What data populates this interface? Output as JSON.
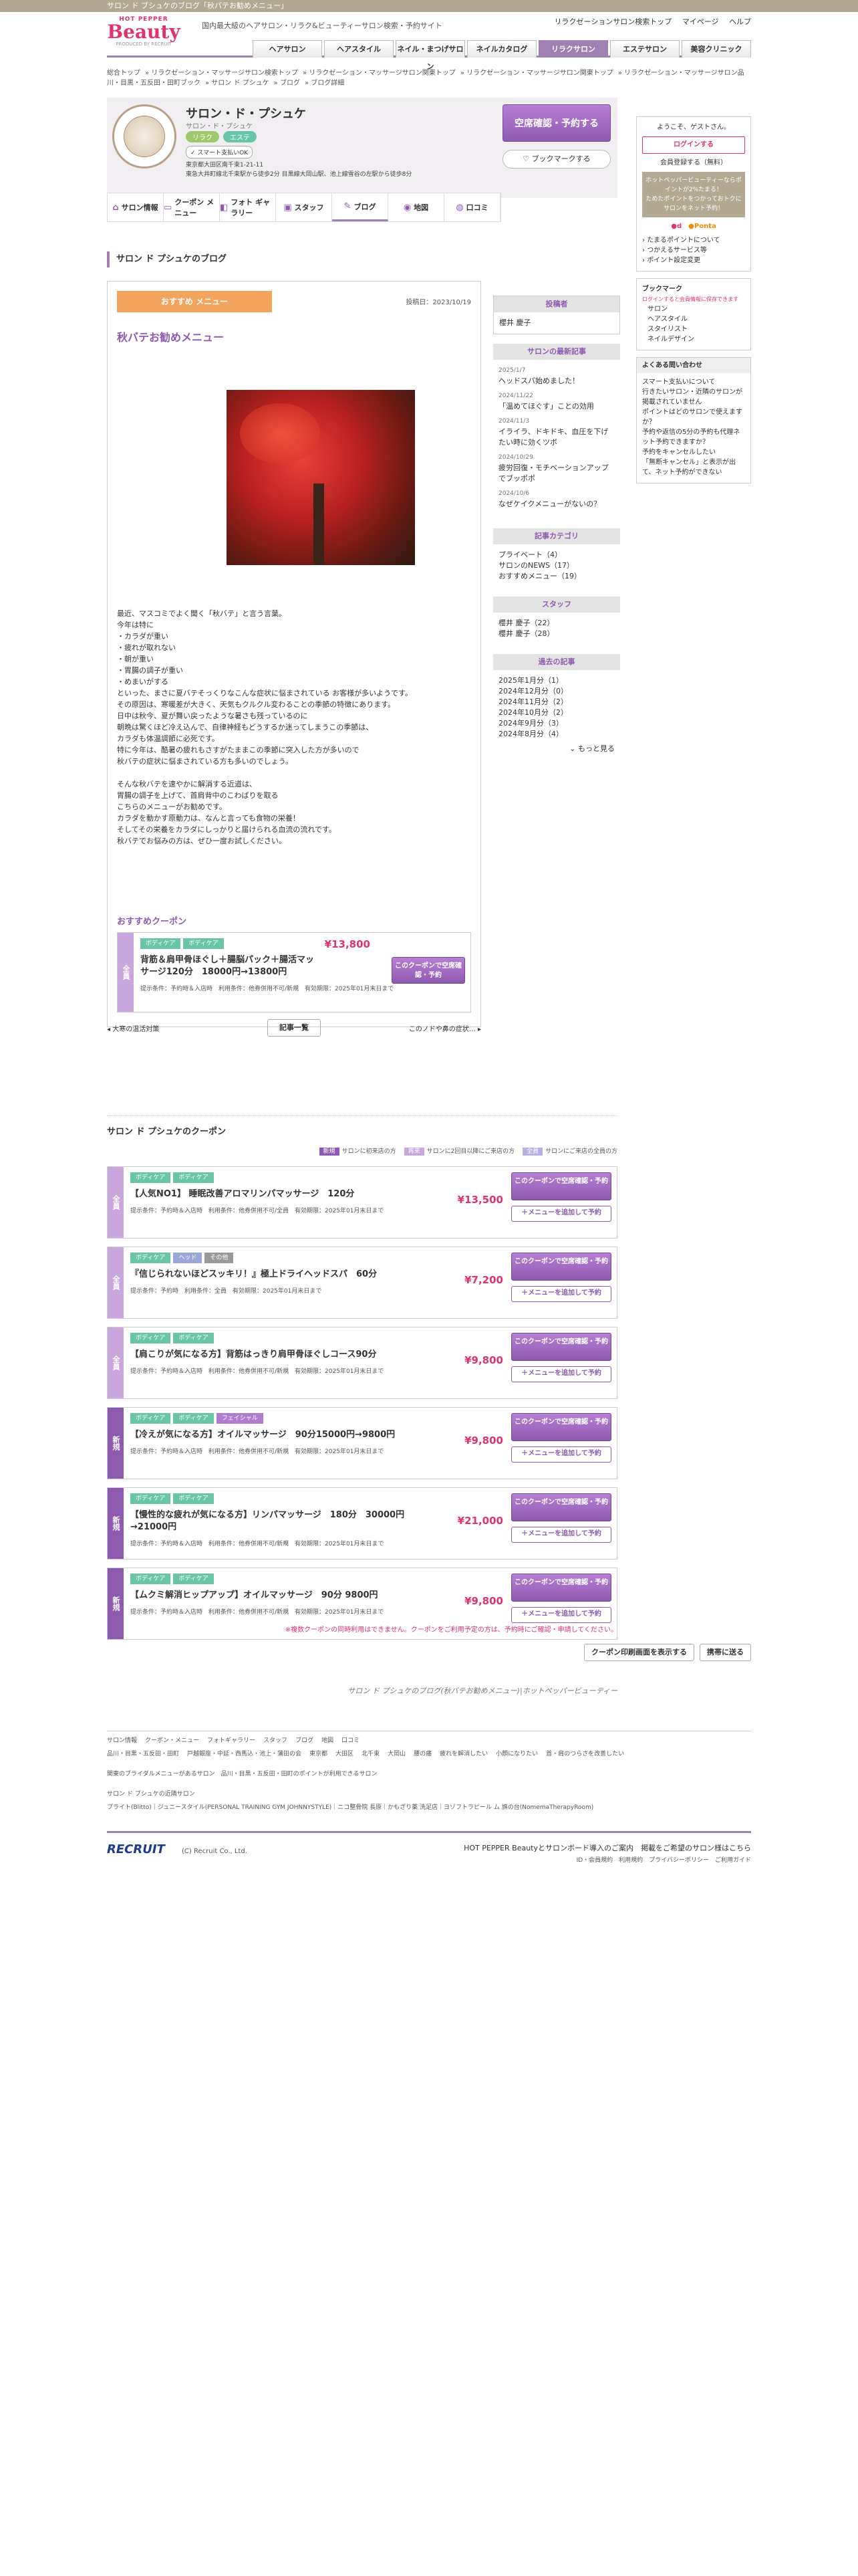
{
  "topbar": {
    "text": "サロン ド ブシュケのブログ「秋パテお勧めメニュー」"
  },
  "header": {
    "logo_small": "HOT PEPPER",
    "logo_big": "Beauty",
    "logo_by": "PRODUCED BY RECRUIT",
    "tagline": "国内最大級のヘアサロン・リラク&ビューティーサロン検索・予約サイト",
    "links": [
      "リラクゼーションサロン検索トップ",
      "マイページ",
      "ヘルプ"
    ],
    "nav": [
      "ヘアサロン",
      "ヘアスタイル",
      "ネイル・まつげサロン",
      "ネイルカタログ",
      "リラクサロン",
      "エステサロン",
      "美容クリニック"
    ]
  },
  "breadcrumb": [
    "総合トップ",
    "リラクゼーション・マッサージサロン検索トップ",
    "リラクゼーション・マッサージサロン関東トップ",
    "リラクゼーション・マッサージサロン関東トップ",
    "リラクゼーション・マッサージサロン品川・目黒・五反田・田町ブック",
    "サロン ド プシュケ",
    "ブログ",
    "ブログ詳細"
  ],
  "salon": {
    "name": "サロン・ド・プシュケ",
    "kana": "サロン・ド・プシュケ",
    "tags": [
      "リラク",
      "エステ"
    ],
    "smart": "スマート支払いOK",
    "address1": "東京都大田区南千束1-21-11",
    "address2": "東急大井町線北千束駅から徒歩2分 目黒線大岡山駅、池上線雪谷の左駅から徒歩8分",
    "reserve": "空席確認・予約する",
    "bookmark": "ブックマークする"
  },
  "subnav": [
    {
      "icon": "⌂",
      "label": "サロン情報"
    },
    {
      "icon": "▭",
      "label": "クーポン メニュー"
    },
    {
      "icon": "◧",
      "label": "フォト ギャラリー"
    },
    {
      "icon": "▣",
      "label": "スタッフ"
    },
    {
      "icon": "✎",
      "label": "ブログ"
    },
    {
      "icon": "◉",
      "label": "地図"
    },
    {
      "icon": "◍",
      "label": "口コミ"
    }
  ],
  "blog": {
    "heading": "サロン ド プシュケのブログ",
    "badge": "おすすめ メニュー",
    "date": "投稿日：2023/10/19",
    "title": "秋バテお勧めメニュー",
    "body": "最近、マスコミでよく聞く「秋バテ」と言う言葉。\n今年は特に\n・カラダが重い\n・疲れが取れない\n・朝が重い\n・胃腸の調子が重い\n・めまいがする\nといった、まさに夏バテそっくりなこんな症状に悩まされている お客様が多いようです。\nその原因は、寒暖差が大きく、天気もクルクル変わることの季節の特徴にあります。\n日中は秋今、夏が舞い戻ったような暑さも残っているのに\n朝晩は驚くほど冷え込んで、自律神経もどうするか迷ってしまうこの季節は、\nカラダも体温調節に必死です。\n特に今年は、酷暑の疲れもさすがたままこの季節に突入した方が多いので\n秋バテの症状に悩まされている方も多いのでしょう。\n\nそんな秋バテを速やかに解消する近道は、\n胃腸の調子を上げて、首肩背中のこわばりを取る\nこちらのメニューがお勧めです。\nカラダを動かす原動力は、なんと言っても食物の栄養！\nそしてその栄養をカラダにしっかりと届けられる血流の流れです。\n秋バテでお悩みの方は、ぜひ一度お試しください。",
    "coupon_heading": "おすすめクーポン",
    "coupon": {
      "side": "全員",
      "labels": [
        "ボディケア",
        "ボディケア"
      ],
      "name": "背筋＆肩甲骨ほぐし＋腸脳パック＋腸活マッサージ120分　18000円→13800円",
      "price": "¥13,800",
      "btn": "このクーポンで空席確認・予約",
      "meta1": "提示条件：予約時＆入店時　利用条件：他券併用不可/新規　有効期限：2025年01月末日まで"
    },
    "prev": "大寒の温活対策",
    "list": "記事一覧",
    "next": "このノドや鼻の症状…"
  },
  "poster": {
    "heading": "投稿者",
    "name": "櫻井 慶子"
  },
  "recent": {
    "heading": "サロンの最新記事",
    "items": [
      {
        "d": "2025/1/7",
        "t": "ヘッドスパ始めました！"
      },
      {
        "d": "2024/11/22",
        "t": "「温めてほぐす」ことの効用"
      },
      {
        "d": "2024/11/3",
        "t": "イライラ、ドキドキ、血圧を下げたい時に効くツボ"
      },
      {
        "d": "2024/10/29",
        "t": "疲労回復・モチベーションアップでブッポポ"
      },
      {
        "d": "2024/10/6",
        "t": "なぜケイクメニューがないの？"
      }
    ]
  },
  "category": {
    "heading": "記事カテゴリ",
    "items": [
      "プライベート（4）",
      "サロンのNEWS（17）",
      "おすすめメニュー（19）"
    ]
  },
  "staff": {
    "heading": "スタッフ",
    "items": [
      "櫻井 慶子（22）",
      "櫻井 慶子（28）"
    ]
  },
  "archive": {
    "heading": "過去の記事",
    "items": [
      "2025年1月分（1）",
      "2024年12月分（0）",
      "2024年11月分（2）",
      "2024年10月分（2）",
      "2024年9月分（3）",
      "2024年8月分（4）"
    ],
    "more": "もっと見る"
  },
  "side": {
    "welcome": "ようこそ、ゲストさん。",
    "login": "ログインする",
    "register": "会員登録する（無料）",
    "promo1": "ホットペッパービューティーならポイントが2%たまる！",
    "promo2": "ためたポイントをつかっておトクにサロンをネット予約！",
    "ptlinks": [
      "たまるポイントについて",
      "つかえるサービス等",
      "ポイント設定変更"
    ],
    "bookmark": "ブックマーク",
    "bm_note": "ログインすると会員情報に保存できます",
    "bm_items": [
      "サロン",
      "ヘアスタイル",
      "スタイリスト",
      "ネイルデザイン"
    ],
    "faq": "よくある問い合わせ",
    "faq_items": [
      "スマート支払いについて",
      "行きたいサロン・近隣のサロンが掲載されていません",
      "ポイントはどのサロンで使えますか？",
      "予約や返信の5分の予約も代理ネット予約できますか？",
      "予約をキャンセルしたい",
      "「無断キャンセル」と表示が出て、ネット予約ができない"
    ]
  },
  "coupons_section": {
    "heading": "サロン ド プシュケのクーポン",
    "legend": [
      {
        "b": "新規",
        "t": "サロンに初来店の方"
      },
      {
        "b": "再来",
        "t": "サロンに2回目以降にご来店の方"
      },
      {
        "b": "全員",
        "t": "サロンにご来店の全員の方"
      }
    ],
    "items": [
      {
        "side": "全員",
        "new": false,
        "labels": [
          "ボディケア",
          "ボディケア"
        ],
        "name": "【人気NO1】 睡眠改善アロマリンパマッサージ　120分",
        "price": "¥13,500",
        "meta": "提示条件：予約時＆入店時　利用条件：他券併用不可/全員　有効期限：2025年01月末日まで"
      },
      {
        "side": "全員",
        "new": false,
        "labels": [
          "ボディケア",
          "ヘッド",
          "その他"
        ],
        "name": "『信じられないほどスッキリ！』極上ドライヘッドスパ　60分",
        "price": "¥7,200",
        "meta": "提示条件：予約時　利用条件：全員　有効期限：2025年01月末日まで"
      },
      {
        "side": "全員",
        "new": false,
        "labels": [
          "ボディケア",
          "ボディケア"
        ],
        "name": "【肩こりが気になる方】背筋はっきり肩甲骨ほぐしコース90分",
        "price": "¥9,800",
        "meta": "提示条件：予約時＆入店時　利用条件：他券併用不可/新規　有効期限：2025年01月末日まで"
      },
      {
        "side": "新規",
        "new": true,
        "labels": [
          "ボディケア",
          "ボディケア",
          "フェイシャル"
        ],
        "name": "【冷えが気になる方】オイルマッサージ　90分15000円→9800円",
        "price": "¥9,800",
        "meta": "提示条件：予約時＆入店時　利用条件：他券併用不可/新規　有効期限：2025年01月末日まで"
      },
      {
        "side": "新規",
        "new": true,
        "labels": [
          "ボディケア",
          "ボディケア"
        ],
        "name": "【慢性的な疲れが気になる方】リンパマッサージ　180分　30000円→21000円",
        "price": "¥21,000",
        "meta": "提示条件：予約時＆入店時　利用条件：他券併用不可/新規　有効期限：2025年01月末日まで"
      },
      {
        "side": "新規",
        "new": true,
        "labels": [
          "ボディケア",
          "ボディケア"
        ],
        "name": "【ムクミ解消ヒップアップ】オイルマッサージ　90分 9800円",
        "price": "¥9,800",
        "meta": "提示条件：予約時＆入店時　利用条件：他券併用不可/新規　有効期限：2025年01月末日まで"
      }
    ],
    "btn": "このクーポンで空席確認・予約",
    "add": "＋メニューを追加して予約",
    "note": "※複数クーポンの同時利用はできません。クーポンをご利用予定の方は、予約時にご確認・申請してください。",
    "print": "クーポン印刷画面を表示する",
    "back": "携帯に送る"
  },
  "caption": "サロン ド プシュケのブログ(秋バテお勧めメニュー)|ホットペッパービューティー",
  "footer": {
    "row1": [
      "サロン情報",
      "クーポン・メニュー",
      "フォトギャラリー",
      "スタッフ",
      "ブログ",
      "地図",
      "口コミ"
    ],
    "row2": [
      "品川・目黒・五反田・田町",
      "戸越銀座・中延・西馬込・池上・蒲田の会",
      "東京都",
      "大田区",
      "北千束",
      "大岡山",
      "腰の痛",
      "疲れを解消したい",
      "小顔になりたい",
      "首・肩のつらさを改善したい"
    ],
    "row3": "関東のブライダルメニューがあるサロン　品川・目黒・五反田・田町のポイントが利用できるサロン",
    "row4": "サロン ド プシュケの近隣サロン",
    "row5": "プライト(Blitto)｜ジュニースタイル(PERSONAL TRAINING GYM JOHNNYSTYLE)｜ニコ整骨院 長原｜かもざり薬 洗足店｜ヨゾフトラピール ム 旗の台(NomemaTherapyRoom)"
  },
  "recruit": {
    "logo": "RECRUIT",
    "copy": "(C) Recruit Co., Ltd.",
    "r1": "HOT PEPPER Beautyとサロンボード導入のご案内　掲載をご希望のサロン様はこちら",
    "r2": "ID・会員規約　利用規約　プライバシーポリシー　ご利用ガイド"
  }
}
